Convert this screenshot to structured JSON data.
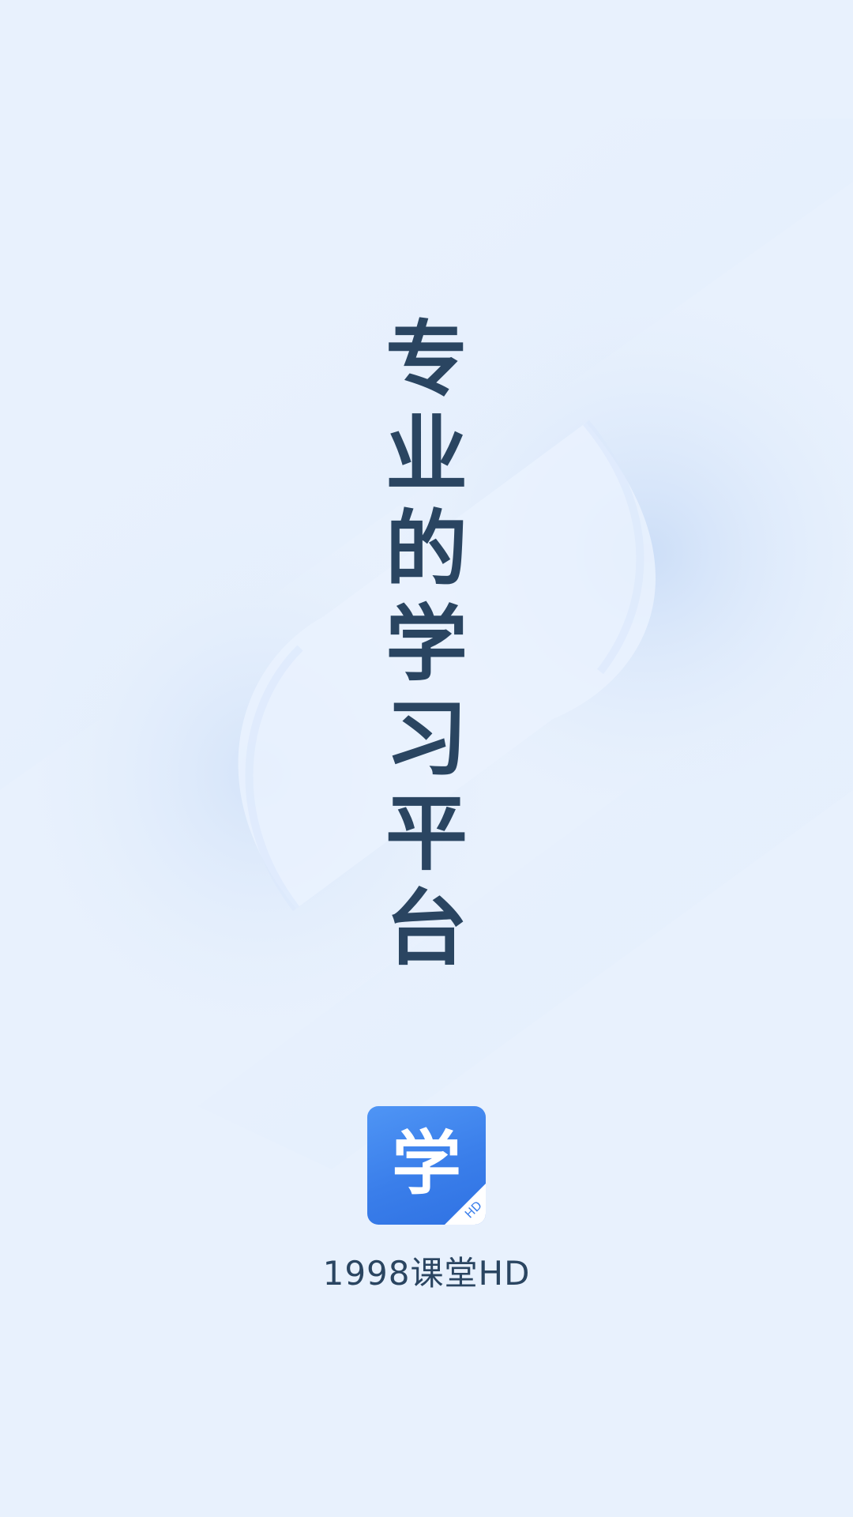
{
  "splash": {
    "slogan_chars": [
      "专",
      "业",
      "的",
      "学",
      "习",
      "平",
      "台"
    ]
  },
  "logo": {
    "glyph": "学",
    "badge": "HD",
    "color": "#3a7eea"
  },
  "app": {
    "name": "1998课堂HD"
  },
  "colors": {
    "background": "#e8f1fd",
    "text": "#2a4561",
    "accent": "#3a7eea"
  }
}
